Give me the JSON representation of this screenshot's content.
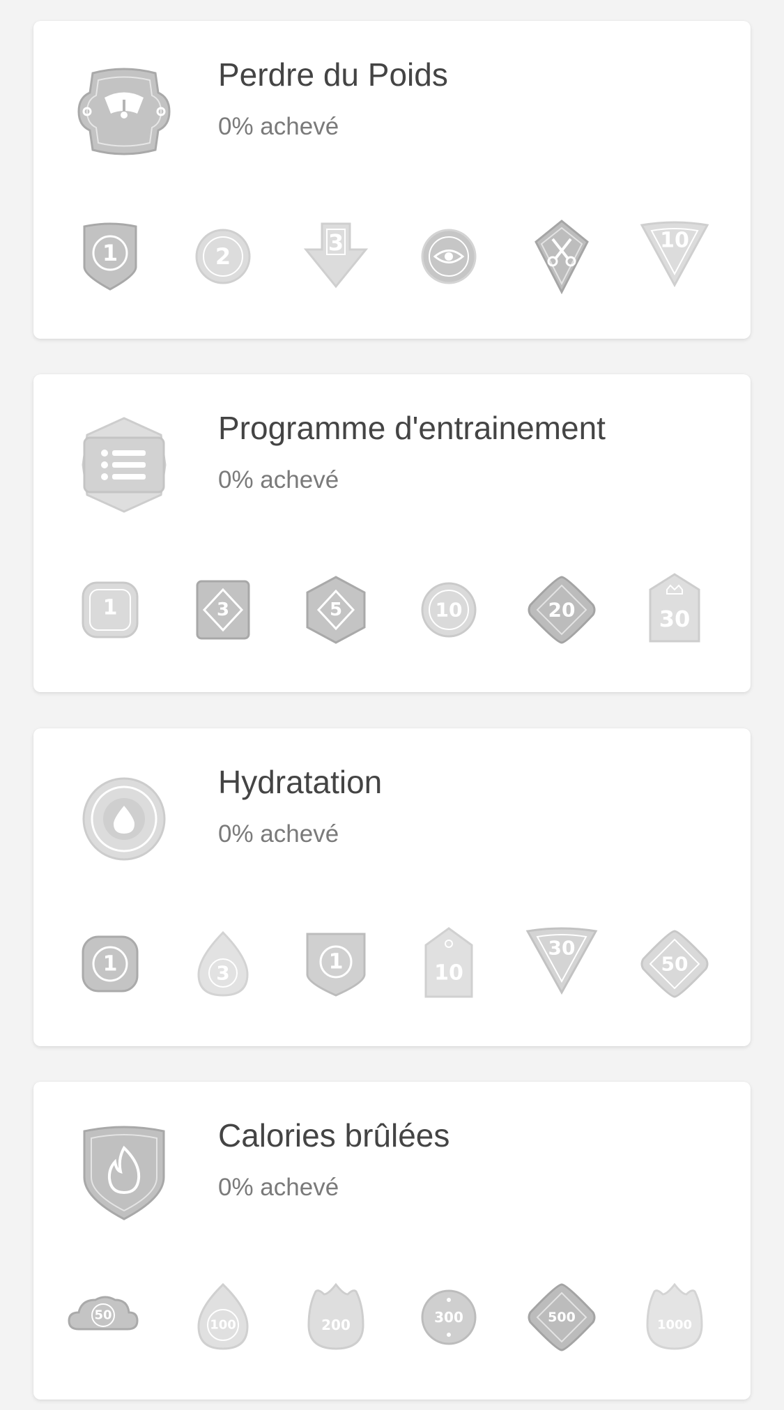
{
  "colors": {
    "background": "#f3f3f3",
    "card": "#ffffff",
    "title": "#444444",
    "subtitle": "#7a7a7a",
    "badge_dark": "#b9b9b9",
    "badge_light": "#dcdcdc"
  },
  "cards": [
    {
      "title": "Perdre du Poids",
      "progress": "0% achevé",
      "main_icon": "scale-icon",
      "badges": [
        {
          "icon": "shield-badge-icon",
          "label": "1"
        },
        {
          "icon": "circle-badge-icon",
          "label": "2"
        },
        {
          "icon": "arrow-down-badge-icon",
          "label": "3"
        },
        {
          "icon": "eye-badge-icon",
          "label": ""
        },
        {
          "icon": "scissors-badge-icon",
          "label": ""
        },
        {
          "icon": "triangle-badge-icon",
          "label": "10"
        }
      ]
    },
    {
      "title": "Programme d'entrainement",
      "progress": "0% achevé",
      "main_icon": "list-icon",
      "badges": [
        {
          "icon": "rounded-square-badge-icon",
          "label": "1"
        },
        {
          "icon": "diamond-square-badge-icon",
          "label": "3"
        },
        {
          "icon": "hexagon-badge-icon",
          "label": "5"
        },
        {
          "icon": "circle-badge-icon",
          "label": "10"
        },
        {
          "icon": "diamond-badge-icon",
          "label": "20"
        },
        {
          "icon": "crown-badge-icon",
          "label": "30"
        }
      ]
    },
    {
      "title": "Hydratation",
      "progress": "0% achevé",
      "main_icon": "water-drop-icon",
      "badges": [
        {
          "icon": "rounded-square-badge-icon",
          "label": "1"
        },
        {
          "icon": "drop-badge-icon",
          "label": "3"
        },
        {
          "icon": "shield-badge-icon",
          "label": "1"
        },
        {
          "icon": "tag-badge-icon",
          "label": "10"
        },
        {
          "icon": "triangle-badge-icon",
          "label": "30"
        },
        {
          "icon": "diamond-badge-icon",
          "label": "50"
        }
      ]
    },
    {
      "title": "Calories brûlées",
      "progress": "0% achevé",
      "main_icon": "flame-icon",
      "badges": [
        {
          "icon": "cloud-badge-icon",
          "label": "50"
        },
        {
          "icon": "drop-badge-icon",
          "label": "100"
        },
        {
          "icon": "flame-badge-icon",
          "label": "200"
        },
        {
          "icon": "circle-badge-icon",
          "label": "300"
        },
        {
          "icon": "diamond-badge-icon",
          "label": "500"
        },
        {
          "icon": "flame-badge-icon",
          "label": "1000"
        }
      ]
    }
  ]
}
